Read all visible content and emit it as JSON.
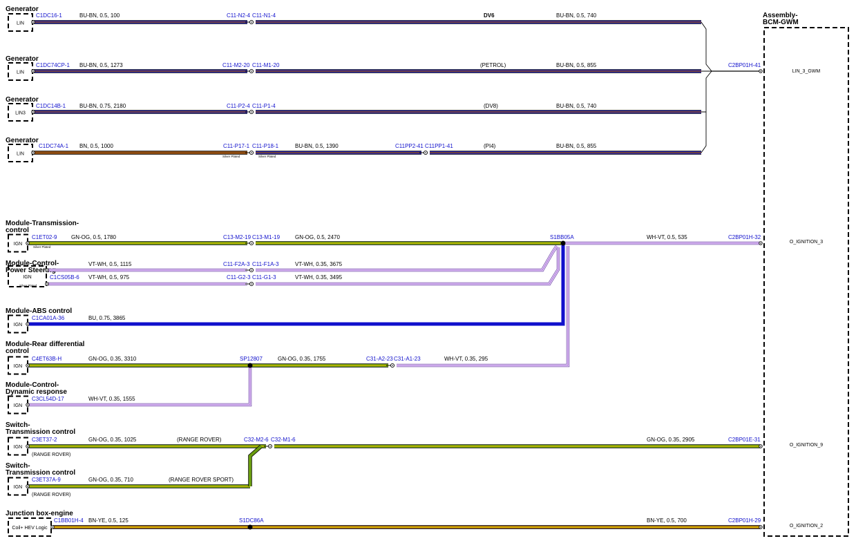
{
  "colors": {
    "BU-BN": [
      "#2020b0",
      "#8a4b12"
    ],
    "BN": [
      "#8a4b12"
    ],
    "GN-OG": [
      "#6a9c10",
      "#c8b400"
    ],
    "WH-VT": [
      "#ffffff",
      "#9b4fd8"
    ],
    "VT-WH": [
      "#ffffff",
      "#9b4fd8"
    ],
    "BU": [
      "#1010cc"
    ],
    "BN-YE": [
      "#8a4b12",
      "#f0d800"
    ]
  },
  "labels": {
    "gen1": "Generator",
    "gen1_pin": "LIN",
    "gen2": "Generator",
    "gen2_pin": "LIN",
    "gen3": "Generator",
    "gen3_pin": "LIN3",
    "gen4": "Generator",
    "gen4_pin": "LIN",
    "tcm_l1": "Module-Transmission-",
    "tcm_l2": "control",
    "tcm_pin": "IGN",
    "ps_l1": "Module-Control-",
    "ps_l2": "Power Steering",
    "ps_pin": "IGN",
    "abs": "Module-ABS control",
    "abs_pin": "IGN",
    "rd_l1": "Module-Rear differential",
    "rd_l2": "control",
    "rd_pin": "IGN",
    "dr_l1": "Module-Control-",
    "dr_l2": "Dynamic response",
    "dr_pin": "IGN",
    "sw1_l1": "Switch-",
    "sw1_l2": "Transmission control",
    "sw1_pin": "IGN",
    "sw2_l1": "Switch-",
    "sw2_l2": "Transmission control",
    "sw2_pin": "IGN",
    "jb": "Junction box-engine",
    "jb_pin": "Coil+ HEV Logic",
    "bcm_l1": "Assembly-",
    "bcm_l2": "BCM-GWM",
    "sig_lin3": "LIN_3_GWM",
    "sig_ign3": "O_IGNITION_3",
    "sig_ign9": "O_IGNITION_9",
    "sig_ign2": "O_IGNITION_2",
    "c_g1a": "C1DC16-1",
    "w_g1a": "BU-BN,  0.5,  100",
    "c_g1b": "C11-N2-4",
    "c_g1c": "C11-N1-4",
    "v_g1": "DV6",
    "w_g1b": "BU-BN,  0.5,  740",
    "c_g2a": "C1DC74CP-1",
    "w_g2a": "BU-BN,  0.5,  1273",
    "c_g2b": "C11-M2-20",
    "c_g2c": "C11-M1-20",
    "v_g2": "(PETROL)",
    "w_g2b": "BU-BN,  0.5,  855",
    "c_bcm41": "C2BP01H-41",
    "c_g3a": "C1DC14B-1",
    "w_g3a": "BU-BN,  0.75,  2180",
    "c_g3b": "C11-P2-4",
    "c_g3c": "C11-P1-4",
    "v_g3": "(DV8)",
    "w_g3b": "BU-BN,  0.5,  740",
    "c_g4a": "C1DC74A-1",
    "w_g4a": "BN,  0.5,  1000",
    "c_g4b": "C11-P17-1",
    "c_g4c": "C11-P18-1",
    "w_g4b": "BU-BN,  0.5,  1390",
    "c_g4d": "C11PP2-41",
    "c_g4e": "C11PP1-41",
    "v_g4": "(PI4)",
    "w_g4c": "BU-BN,  0.5,  855",
    "sp1": "Silver Plated",
    "sp2": "Silver Plated",
    "sp3": "Silver Plated",
    "sp4": "Silver Plated",
    "c_t1": "C1ET02-9",
    "w_t1": "GN-OG,  0.5,  1780",
    "c_t2": "C13-M2-19",
    "c_t3": "C13-M1-19",
    "w_t2": "GN-OG,  0.5,  2470",
    "s_bb": "S1BB05A",
    "w_t3": "WH-VT,  0.5,  535",
    "c_bcm32": "C2BP01H-32",
    "c_p1": "C11-F2A-3",
    "c_p2": "C11-F1A-3",
    "w_p1": "VT-WH,  0.5,  1115",
    "w_p2": "VT-WH,  0.35,  3675",
    "c_p0": "C1CS05B-6",
    "w_p3": "VT-WH,  0.5,  975",
    "c_p3": "C11-G2-3",
    "c_p4": "C11-G1-3",
    "w_p4": "VT-WH,  0.35,  3495",
    "c_a1": "C1CA01A-36",
    "w_a1": "BU,  0.75,  3865",
    "c_r1": "C4ET63B-H",
    "w_r1": "GN-OG,  0.35,  3310",
    "s_sp": "SP12807",
    "w_r2": "GN-OG,  0.35,  1755",
    "c_r2": "C31-A2-23",
    "c_r3": "C31-A1-23",
    "w_r3": "WH-VT,  0.35,  295",
    "c_d1": "C3CL54D-17",
    "w_d1": "WH-VT,  0.35,  1555",
    "c_s1": "C3ET37-2",
    "w_s1": "GN-OG,  0.35,  1025",
    "v_s1": "(RANGE ROVER)",
    "c_s2": "C32-M2-6",
    "c_s3": "C32-M1-6",
    "w_s2": "GN-OG,  0.35,  2905",
    "c_bcm31": "C2BP01E-31",
    "n_s1": "(RANGE ROVER)",
    "c_s4": "C3ET37A-9",
    "w_s4": "GN-OG,  0.35,  710",
    "v_s4": "(RANGE ROVER SPORT)",
    "n_s4": "(RANGE ROVER)",
    "c_j1": "C1BB01H-4",
    "w_j1": "BN-YE,  0.5,  125",
    "s_j": "S1DC86A",
    "w_j2": "BN-YE,  0.5,  700",
    "c_bcm29": "C2BP01H-29"
  }
}
